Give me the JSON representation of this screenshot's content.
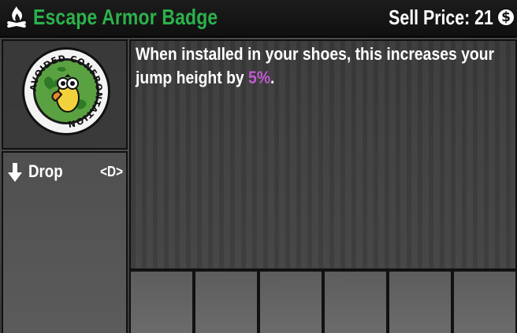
{
  "header": {
    "icon": "campfire-icon",
    "title": "Escape Armor Badge",
    "sell_label": "Sell Price: 21",
    "currency_icon": "dukes-coin-icon",
    "currency_symbol": "$",
    "title_color": "#2bb24c"
  },
  "item": {
    "icon": "avoided-confrontation-badge-icon",
    "badge_text": "AVOIDED CONFRONTATION",
    "description_prefix": "When installed in your shoes, this increases your jump height by ",
    "description_value": "5%",
    "description_suffix": ".",
    "highlight_color": "#c35ad2"
  },
  "actions": [
    {
      "icon": "down-arrow-icon",
      "label": "Drop",
      "key": "<D>"
    }
  ],
  "slots": [
    {},
    {},
    {},
    {},
    {},
    {}
  ]
}
